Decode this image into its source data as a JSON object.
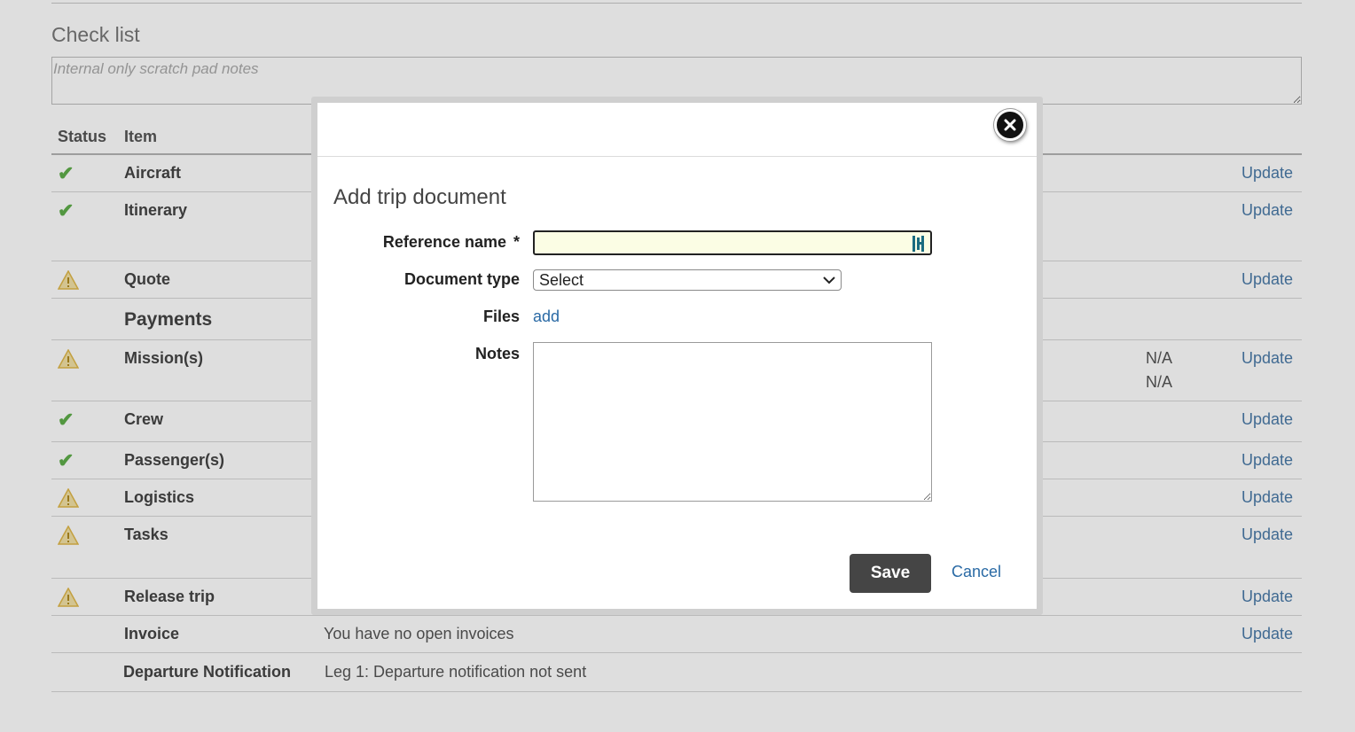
{
  "checklist": {
    "title": "Check list",
    "scratch_placeholder": "Internal only scratch pad notes",
    "headers": {
      "status": "Status",
      "item": "Item"
    },
    "rows": [
      {
        "item": "Aircraft",
        "status": "ok",
        "update": "Update"
      },
      {
        "item": "Itinerary",
        "status": "ok",
        "update": "Update"
      },
      {
        "item": "Quote",
        "status": "warning",
        "update": "Update"
      },
      {
        "item": "Payments",
        "status": "none"
      },
      {
        "item": "Mission(s)",
        "status": "warning",
        "na1": "N/A",
        "na2": "N/A",
        "update": "Update"
      },
      {
        "item": "Crew",
        "status": "ok",
        "update": "Update"
      },
      {
        "item": "Passenger(s)",
        "status": "ok",
        "update": "Update"
      },
      {
        "item": "Logistics",
        "status": "warning",
        "update": "Update"
      },
      {
        "item": "Tasks",
        "status": "warning",
        "update": "Update"
      },
      {
        "item": "Release trip",
        "status": "warning",
        "update": "Update"
      },
      {
        "item": "Invoice",
        "status": "none",
        "description": "You have no open invoices",
        "update": "Update"
      },
      {
        "item": "Departure Notification",
        "status": "none",
        "description": "Leg 1: Departure notification not sent"
      }
    ]
  },
  "dialog": {
    "title": "Add trip document",
    "reference_label": "Reference name",
    "required_mark": "*",
    "reference_value": "",
    "document_type_label": "Document type",
    "document_type_value": "Select",
    "files_label": "Files",
    "files_add": "add",
    "notes_label": "Notes",
    "notes_value": "",
    "save_label": "Save",
    "cancel_label": "Cancel"
  },
  "icons": {
    "ok": "check-icon",
    "warning": "warning-icon",
    "close": "close-icon"
  },
  "colors": {
    "ok": "#5fae4a",
    "warning": "#e0b84a",
    "link": "#2a6aa5",
    "save_button": "#454545"
  }
}
